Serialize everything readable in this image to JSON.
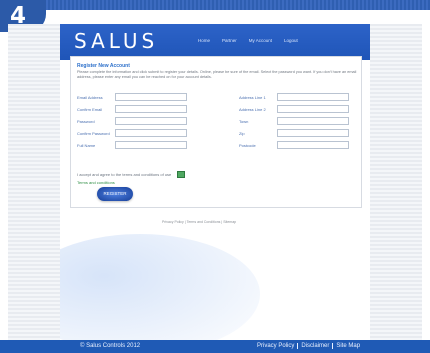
{
  "badge": "4",
  "brand": "SALUS",
  "nav": [
    "Home",
    "Partner",
    "My Account",
    "Logout"
  ],
  "form": {
    "title": "Register New Account",
    "intro": "Please complete the information and click submit to register your details. Online, please be sure of the email. Select the password you want. If you don't have an email address, please enter any email you can be reached on for your account details.",
    "left_labels": [
      "Email Address",
      "Confirm Email",
      "Password",
      "Confirm Password",
      "Full Name"
    ],
    "right_labels": [
      "Address Line 1",
      "Address Line 2",
      "Town",
      "Zip",
      "Postcode"
    ],
    "terms_text": "I accept and agree to the terms and conditions of use",
    "terms_link": "Terms and conditions",
    "register_label": "REGISTER"
  },
  "under_links": "Privacy Policy | Terms and Conditions | Sitemap",
  "footer": {
    "copyright": "© Salus Controls 2012",
    "links": [
      "Privacy Policy",
      "Disclaimer",
      "Site Map"
    ]
  }
}
